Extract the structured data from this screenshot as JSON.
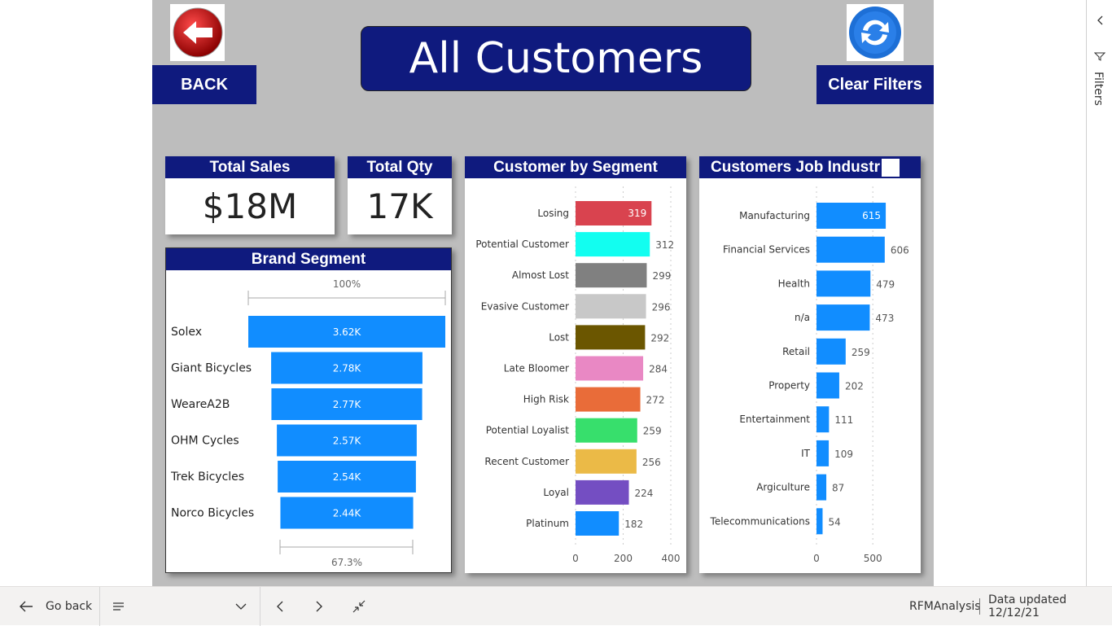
{
  "header": {
    "title": "All Customers",
    "back_label": "BACK",
    "clear_label": "Clear Filters"
  },
  "kpis": {
    "sales_title": "Total Sales",
    "sales_value": "$18M",
    "qty_title": "Total Qty",
    "qty_value": "17K"
  },
  "brand_segment": {
    "title": "Brand Segment",
    "top_pct": "100%",
    "bottom_pct": "67.3%"
  },
  "segment_chart": {
    "title": "Customer by Segment"
  },
  "industry_chart": {
    "title": "Customers Job Industr"
  },
  "filters_pane": {
    "label": "Filters"
  },
  "bottom_bar": {
    "go_back": "Go back",
    "report_name": "RFMAnalysis",
    "data_updated": "Data updated 12/12/21"
  },
  "colors": {
    "navy": "#0f1a7e",
    "bar_blue": "#118dff",
    "canvas": "#bdbdbd"
  },
  "chart_data": [
    {
      "type": "bar",
      "name": "Brand Segment",
      "orientation": "funnel",
      "categories": [
        "Solex",
        "Giant Bicycles",
        "WeareA2B",
        "OHM Cycles",
        "Trek Bicycles",
        "Norco Bicycles"
      ],
      "values": [
        3620,
        2780,
        2770,
        2570,
        2540,
        2440
      ],
      "labels": [
        "3.62K",
        "2.78K",
        "2.77K",
        "2.57K",
        "2.54K",
        "2.44K"
      ]
    },
    {
      "type": "bar",
      "name": "Customer by Segment",
      "orientation": "horizontal",
      "categories": [
        "Losing",
        "Potential Customer",
        "Almost Lost",
        "Evasive Customer",
        "Lost",
        "Late Bloomer",
        "High Risk",
        "Potential Loyalist",
        "Recent Customer",
        "Loyal",
        "Platinum"
      ],
      "values": [
        319,
        312,
        299,
        296,
        292,
        284,
        272,
        259,
        256,
        224,
        182
      ],
      "colors": [
        "#d9434f",
        "#12fef0",
        "#808080",
        "#c8c8c8",
        "#6b5600",
        "#e988c4",
        "#e96c39",
        "#37df6c",
        "#ebba47",
        "#744ec2",
        "#118dff"
      ],
      "xticks": [
        "0",
        "200",
        "400"
      ],
      "xlim": [
        0,
        400
      ]
    },
    {
      "type": "bar",
      "name": "Customers Job Industry",
      "orientation": "horizontal",
      "categories": [
        "Manufacturing",
        "Financial Services",
        "Health",
        "n/a",
        "Retail",
        "Property",
        "Entertainment",
        "IT",
        "Argiculture",
        "Telecommunications"
      ],
      "values": [
        615,
        606,
        479,
        473,
        259,
        202,
        111,
        109,
        87,
        54
      ],
      "xticks": [
        "0",
        "500"
      ],
      "xlim": [
        0,
        900
      ]
    }
  ]
}
